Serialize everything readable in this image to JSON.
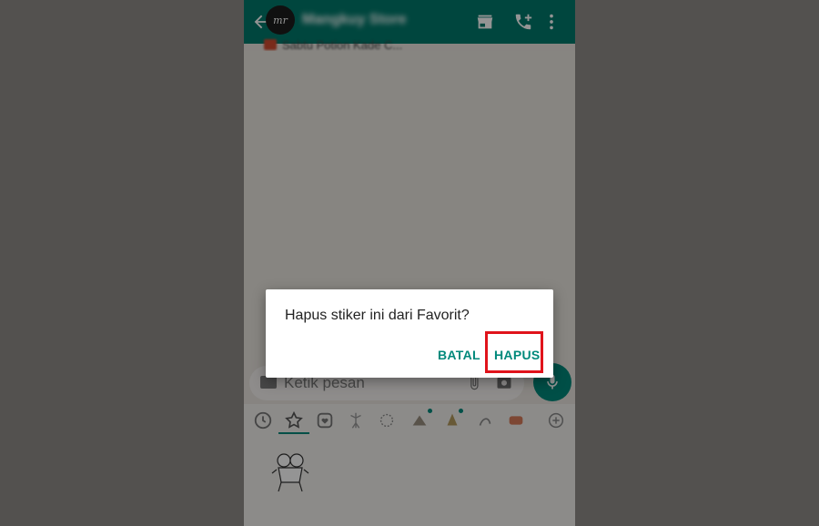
{
  "header": {
    "avatar_text": "mr",
    "contact_name": "Mangkuy Store",
    "pinned_text": "Sabtu Potion Kade C..."
  },
  "input": {
    "placeholder": "Ketik pesan"
  },
  "sticker_tabs": [
    "recent-icon",
    "star-icon",
    "heart-icon",
    "sticker-pack-1",
    "sticker-pack-2",
    "sticker-pack-3",
    "sticker-pack-4",
    "sticker-pack-5",
    "sticker-pack-6",
    "add-icon"
  ],
  "dialog": {
    "message": "Hapus stiker ini dari Favorit?",
    "cancel_label": "BATAL",
    "confirm_label": "HAPUS"
  },
  "colors": {
    "header": "#00796b",
    "accent": "#00897b",
    "highlight": "#e0131b"
  }
}
